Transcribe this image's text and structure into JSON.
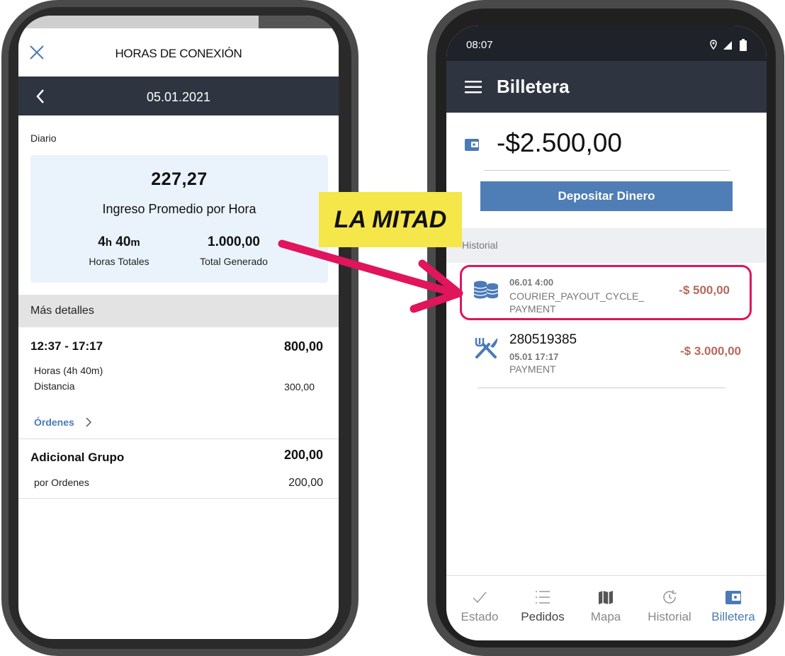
{
  "left_screen": {
    "header_title": "HORAS DE CONEXIÓN",
    "date": "05.01.2021",
    "section_label": "Diario",
    "summary": {
      "avg_value": "227,27",
      "avg_label": "Ingreso Promedio por Hora",
      "hours_h": "4",
      "hours_h_unit": "h",
      "hours_m": "40",
      "hours_m_unit": "m",
      "hours_label": "Horas Totales",
      "total_value": "1.000,00",
      "total_label": "Total Generado"
    },
    "details_header": "Más detalles",
    "shift": {
      "time_range": "12:37 - 17:17",
      "amount": "800,00",
      "hours_line": "Horas (4h 40m)",
      "distance_label": "Distancia",
      "distance_value": "300,00",
      "orders_link": "Órdenes"
    },
    "group_bonus": {
      "title": "Adicional Grupo",
      "amount": "200,00",
      "per_orders_label": "por Ordenes",
      "per_orders_value": "200,00"
    }
  },
  "right_screen": {
    "status_time": "08:07",
    "app_title": "Billetera",
    "balance": "-$2.500,00",
    "deposit_button": "Depositar Dinero",
    "history_label": "Historial",
    "transactions": [
      {
        "date": "06.01  4:00",
        "description": "COURIER_PAYOUT_CYCLE_ PAYMENT",
        "amount": "-$ 500,00"
      },
      {
        "id": "280519385",
        "date": "05.01  17:17",
        "type": "PAYMENT",
        "amount": "-$ 3.000,00"
      }
    ],
    "nav": [
      {
        "label": "Estado"
      },
      {
        "label": "Pedidos"
      },
      {
        "label": "Mapa"
      },
      {
        "label": "Historial"
      },
      {
        "label": "Billetera"
      }
    ]
  },
  "overlay": {
    "callout_text": "LA MITAD",
    "accent_color": "#e0155c",
    "callout_color": "#f5e649"
  }
}
